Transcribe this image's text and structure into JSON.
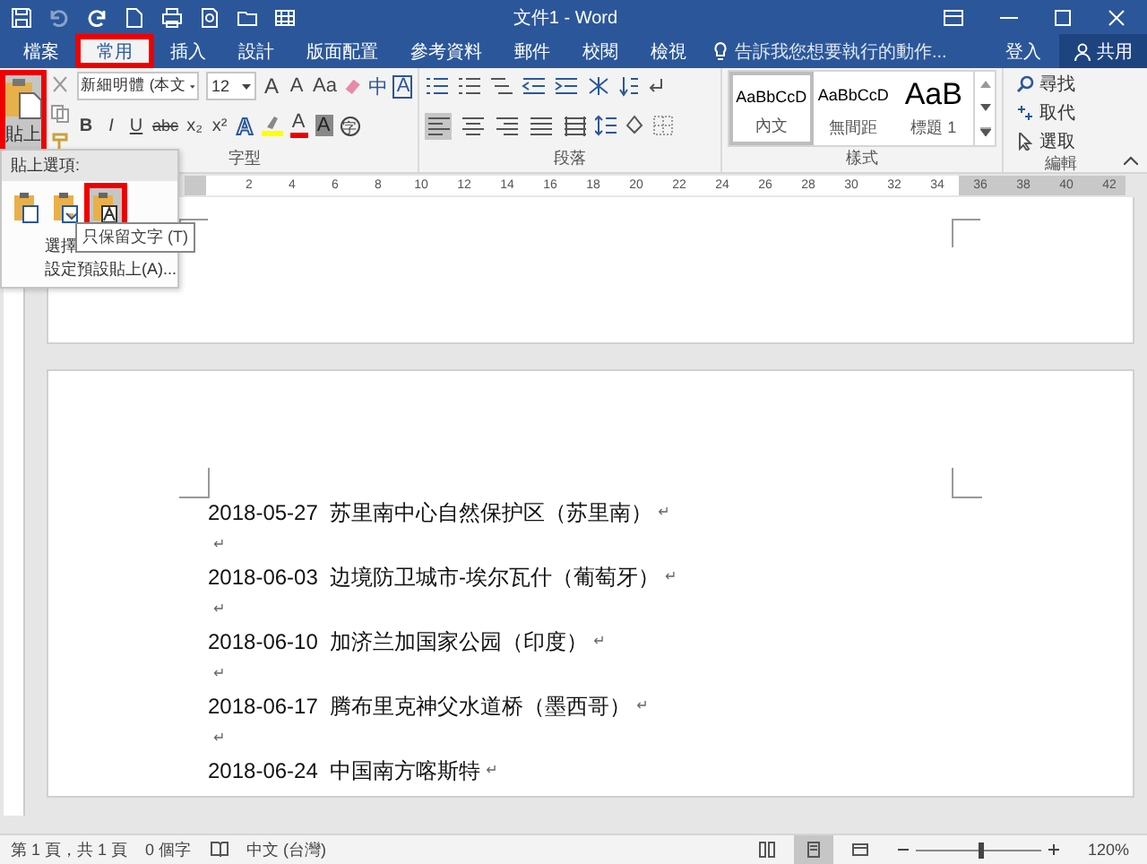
{
  "window": {
    "title": "文件1 - Word"
  },
  "tabs": [
    {
      "label": "檔案",
      "selected": false
    },
    {
      "label": "常用",
      "selected": true
    },
    {
      "label": "插入",
      "selected": false
    },
    {
      "label": "設計",
      "selected": false
    },
    {
      "label": "版面配置",
      "selected": false
    },
    {
      "label": "參考資料",
      "selected": false
    },
    {
      "label": "郵件",
      "selected": false
    },
    {
      "label": "校閱",
      "selected": false
    },
    {
      "label": "檢視",
      "selected": false
    }
  ],
  "tell_me": {
    "placeholder": "告訴我您想要執行的動作..."
  },
  "account": {
    "sign_in": "登入",
    "share": "共用"
  },
  "ribbon": {
    "paste": {
      "label": "貼上",
      "pressed": true
    },
    "font": {
      "label": "字型",
      "font_name": "新細明體 (本文",
      "font_size": "12",
      "grow": "A",
      "shrink": "A",
      "case": "Aa",
      "phonetic": "中",
      "boxed": "A",
      "styles": [
        "B",
        "I",
        "U",
        "abc",
        "x₂",
        "x²"
      ],
      "effects": "A",
      "font_color": "A",
      "shade": "A",
      "enclose": "字"
    },
    "paragraph": {
      "label": "段落",
      "alignments": [
        {
          "selected": true
        },
        {
          "selected": false
        },
        {
          "selected": false
        },
        {
          "selected": false
        },
        {
          "selected": false
        }
      ]
    },
    "styles": {
      "label": "樣式",
      "items": [
        {
          "sample": "AaBbCcD",
          "name": "內文",
          "kind": "normal",
          "selected": true
        },
        {
          "sample": "AaBbCcD",
          "name": "無間距",
          "kind": "normal",
          "selected": false
        },
        {
          "sample": "AaB",
          "name": "標題 1",
          "kind": "heading",
          "selected": false
        }
      ]
    },
    "editing": {
      "label": "編輯",
      "items": [
        "尋找",
        "取代",
        "選取"
      ]
    }
  },
  "paste_menu": {
    "header": "貼上選項:",
    "options": [
      {
        "selected": false
      },
      {
        "selected": false
      },
      {
        "selected": true
      }
    ],
    "items": [
      "選擇",
      "設定預設貼上(A)..."
    ],
    "tooltip": "只保留文字 (T)"
  },
  "ruler": [
    "2",
    "4",
    "6",
    "8",
    "10",
    "12",
    "14",
    "16",
    "18",
    "20",
    "22",
    "24",
    "26",
    "28",
    "30",
    "32",
    "34",
    "36",
    "38",
    "40",
    "42"
  ],
  "paragraph_mark": "↵",
  "document": [
    {
      "kind": "entry",
      "date": "2018-05-27",
      "text": "苏里南中心自然保护区（苏里南）"
    },
    {
      "kind": "empty"
    },
    {
      "kind": "entry",
      "date": "2018-06-03",
      "text": "边境防卫城市-埃尔瓦什（葡萄牙）"
    },
    {
      "kind": "empty"
    },
    {
      "kind": "entry",
      "date": "2018-06-10",
      "text": "加济兰加国家公园（印度）"
    },
    {
      "kind": "empty"
    },
    {
      "kind": "entry",
      "date": "2018-06-17",
      "text": "腾布里克神父水道桥（墨西哥）"
    },
    {
      "kind": "empty"
    },
    {
      "kind": "entry",
      "date": "2018-06-24",
      "text": "中国南方喀斯特"
    }
  ],
  "status_bar": {
    "page": "第 1 頁，共 1 頁",
    "words": "0 個字",
    "language": "中文 (台灣)",
    "views": [
      {
        "selected": false
      },
      {
        "selected": true
      },
      {
        "selected": false
      }
    ],
    "zoom": {
      "level": 0.5,
      "reading": "120%"
    }
  }
}
